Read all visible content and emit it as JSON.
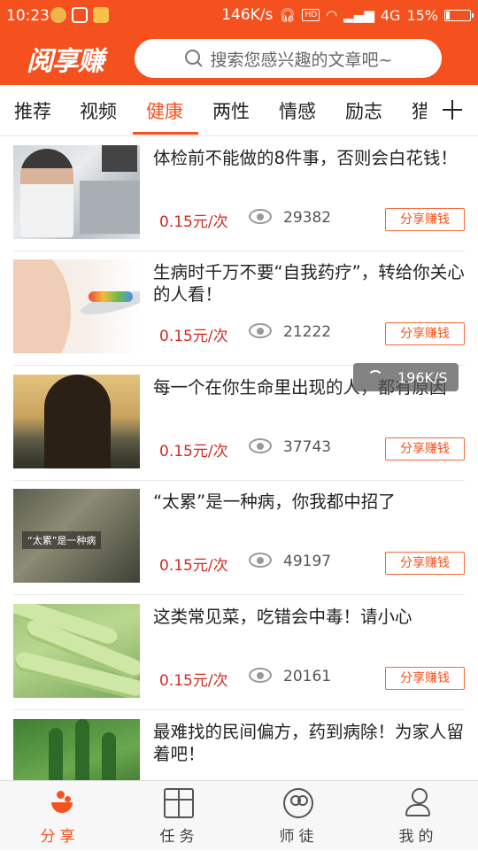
{
  "status_bar": {
    "time": "10:23",
    "speed": "146K/s",
    "network": "4G",
    "battery": "15%"
  },
  "header": {
    "logo": "阅享赚",
    "search_placeholder": "搜索您感兴趣的文章吧~"
  },
  "tabs": [
    {
      "label": "推荐",
      "active": false
    },
    {
      "label": "视频",
      "active": false
    },
    {
      "label": "健康",
      "active": true
    },
    {
      "label": "两性",
      "active": false
    },
    {
      "label": "情感",
      "active": false
    },
    {
      "label": "励志",
      "active": false
    },
    {
      "label": "猎奇",
      "active": false
    }
  ],
  "articles": [
    {
      "title": "体检前不能做的8件事，否则会白花钱！",
      "price": "0.15元/次",
      "views": "29382",
      "share_label": "分享赚钱"
    },
    {
      "title": "生病时千万不要“自我药疗”，转给你关心的人看！",
      "price": "0.15元/次",
      "views": "21222",
      "share_label": "分享赚钱"
    },
    {
      "title": "每一个在你生命里出现的人，都有原因",
      "price": "0.15元/次",
      "views": "37743",
      "share_label": "分享赚钱"
    },
    {
      "title": "“太累”是一种病，你我都中招了",
      "price": "0.15元/次",
      "views": "49197",
      "share_label": "分享赚钱",
      "thumb_caption": "“太累”是一种病"
    },
    {
      "title": "这类常见菜，吃错会中毒！请小心",
      "price": "0.15元/次",
      "views": "20161",
      "share_label": "分享赚钱"
    },
    {
      "title": "最难找的民间偏方，药到病除！为家人留着吧！",
      "price": "",
      "views": "",
      "share_label": ""
    }
  ],
  "speed_overlay": {
    "label": "196K/S"
  },
  "bottom_nav": [
    {
      "label": "分享",
      "icon": "share-icon",
      "active": true
    },
    {
      "label": "任务",
      "icon": "gift-icon",
      "active": false
    },
    {
      "label": "师徒",
      "icon": "mentor-icon",
      "active": false
    },
    {
      "label": "我的",
      "icon": "profile-icon",
      "active": false
    }
  ],
  "colors": {
    "brand": "#f4511e",
    "price": "#d12b1f"
  }
}
